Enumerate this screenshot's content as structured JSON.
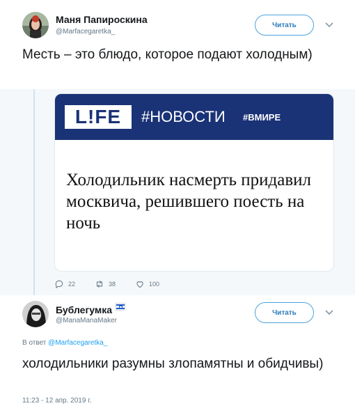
{
  "tweet1": {
    "author_name": "Маня Папироскина",
    "author_handle": "@Marfacegaretka_",
    "follow_label": "Читать",
    "text": "Месть – это блюдо, которое подают холодным)"
  },
  "card": {
    "logo_text": "L!FE",
    "tag": "#НОВОСТИ",
    "subtag": "#ВМИРЕ",
    "headline": "Холодильник насмерть придавил москвича, решившего поесть на ночь",
    "brand_color": "#1a3276"
  },
  "actions": {
    "replies": "22",
    "retweets": "38",
    "likes": "100"
  },
  "tweet2": {
    "author_name": "Бублегумка",
    "author_handle": "@ManaManaMaker",
    "follow_label": "Читать",
    "reply_prefix": "В ответ",
    "reply_handle": "@Marfacegaretka_",
    "text": "холодильники разумны злопамятны и обидчивы)",
    "timestamp": "11:23 - 12 апр. 2019 г."
  },
  "colors": {
    "accent": "#1da1f2",
    "thread_bg": "#f5f8fa",
    "muted": "#657786"
  },
  "icons": [
    "reply-icon",
    "retweet-icon",
    "like-icon",
    "chevron-down-icon",
    "israel-flag-icon"
  ]
}
